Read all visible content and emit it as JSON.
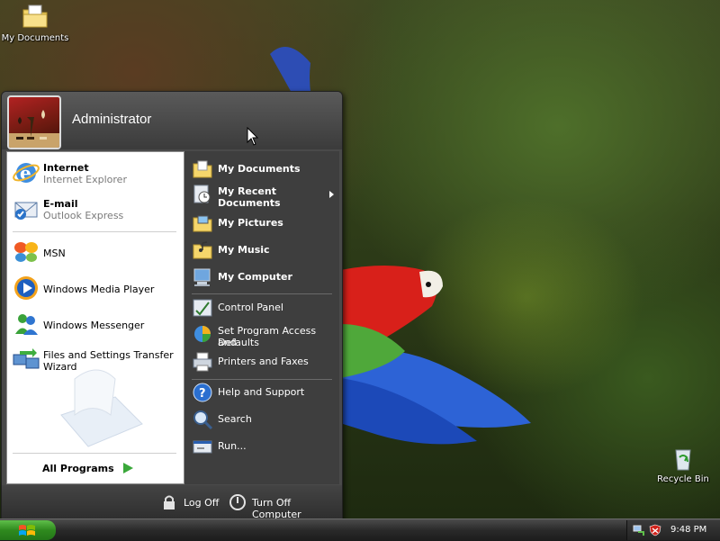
{
  "desktop": {
    "icons": [
      {
        "label": "My Documents",
        "icon": "my-documents-folder-icon"
      },
      {
        "label": "Recycle Bin",
        "icon": "recycle-bin-icon"
      }
    ]
  },
  "start_menu": {
    "user": {
      "name": "Administrator",
      "avatar": "chess-pieces-avatar"
    },
    "pinned": [
      {
        "title": "Internet",
        "subtitle": "Internet Explorer",
        "icon": "internet-explorer-icon"
      },
      {
        "title": "E-mail",
        "subtitle": "Outlook Express",
        "icon": "outlook-express-icon"
      }
    ],
    "recent": [
      {
        "label": "MSN",
        "icon": "msn-butterfly-icon"
      },
      {
        "label": "Windows Media Player",
        "icon": "windows-media-player-icon"
      },
      {
        "label": "Windows Messenger",
        "icon": "windows-messenger-icon"
      },
      {
        "label": "Files and Settings Transfer Wizard",
        "label_line1": "Files and Settings Transfer",
        "label_line2": "Wizard",
        "icon": "transfer-wizard-icon"
      }
    ],
    "all_programs": {
      "label": "All Programs",
      "icon": "green-arrow-icon"
    },
    "places": [
      {
        "label": "My Documents",
        "icon": "folder-documents-icon"
      },
      {
        "label": "My Recent Documents",
        "line1": "My Recent",
        "line2": "Documents",
        "icon": "recent-documents-icon",
        "has_submenu": true
      },
      {
        "label": "My Pictures",
        "icon": "folder-pictures-icon"
      },
      {
        "label": "My Music",
        "icon": "folder-music-icon"
      },
      {
        "label": "My Computer",
        "icon": "computer-icon"
      }
    ],
    "settings": [
      {
        "label": "Control Panel",
        "icon": "control-panel-icon"
      },
      {
        "label": "Set Program Access and Defaults",
        "line1": "Set Program Access and",
        "line2": "Defaults",
        "icon": "program-access-icon"
      },
      {
        "label": "Printers and Faxes",
        "icon": "printer-icon"
      }
    ],
    "help": [
      {
        "label": "Help and Support",
        "icon": "help-icon"
      },
      {
        "label": "Search",
        "icon": "search-icon"
      },
      {
        "label": "Run...",
        "icon": "run-icon"
      }
    ],
    "footer": {
      "log_off": "Log Off",
      "turn_off": "Turn Off Computer"
    }
  },
  "taskbar": {
    "start_label": "",
    "clock": "9:48 PM",
    "tray_icons": [
      "network-icon",
      "security-shield-icon"
    ]
  },
  "colors": {
    "menu_dark": "#3e3e3e",
    "left_pane": "#ffffff",
    "start_green": "#2f8a1e",
    "taskbar": "#2a2a2a"
  }
}
